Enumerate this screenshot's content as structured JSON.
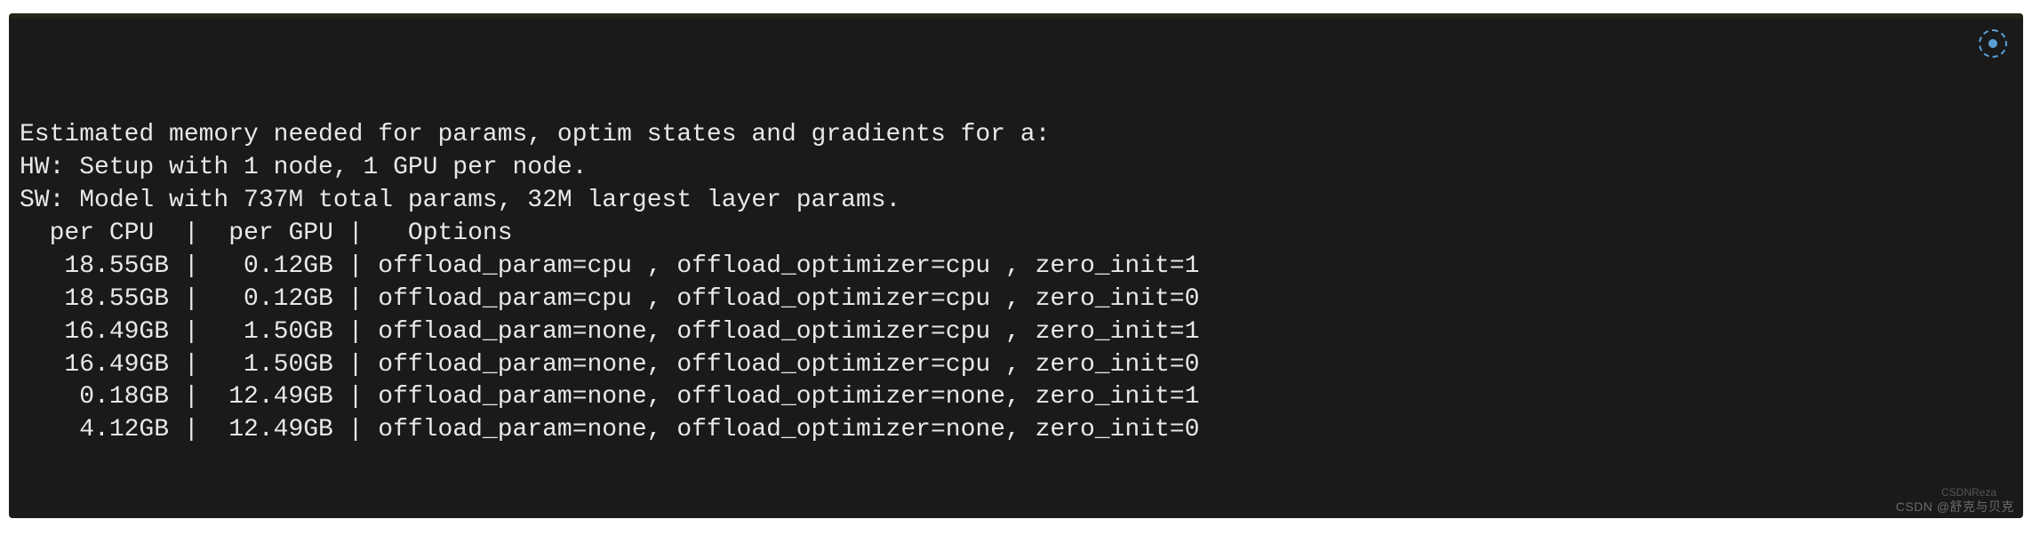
{
  "terminal": {
    "intro_line": "Estimated memory needed for params, optim states and gradients for a:",
    "hw_line": "HW: Setup with 1 node, 1 GPU per node.",
    "sw_line": "SW: Model with 737M total params, 32M largest layer params.",
    "headers": {
      "per_cpu": "  per CPU  ",
      "per_gpu": "  per GPU ",
      "options": "   Options"
    },
    "rows": [
      {
        "per_cpu": "   18.55GB ",
        "per_gpu": "   0.12GB ",
        "options": " offload_param=cpu , offload_optimizer=cpu , zero_init=1"
      },
      {
        "per_cpu": "   18.55GB ",
        "per_gpu": "   0.12GB ",
        "options": " offload_param=cpu , offload_optimizer=cpu , zero_init=0"
      },
      {
        "per_cpu": "   16.49GB ",
        "per_gpu": "   1.50GB ",
        "options": " offload_param=none, offload_optimizer=cpu , zero_init=1"
      },
      {
        "per_cpu": "   16.49GB ",
        "per_gpu": "   1.50GB ",
        "options": " offload_param=none, offload_optimizer=cpu , zero_init=0"
      },
      {
        "per_cpu": "    0.18GB ",
        "per_gpu": "  12.49GB ",
        "options": " offload_param=none, offload_optimizer=none, zero_init=1"
      },
      {
        "per_cpu": "    4.12GB ",
        "per_gpu": "  12.49GB ",
        "options": " offload_param=none, offload_optimizer=none, zero_init=0"
      }
    ]
  },
  "watermark": {
    "top": "CSDNReza",
    "bottom": "CSDN @舒克与贝克"
  }
}
